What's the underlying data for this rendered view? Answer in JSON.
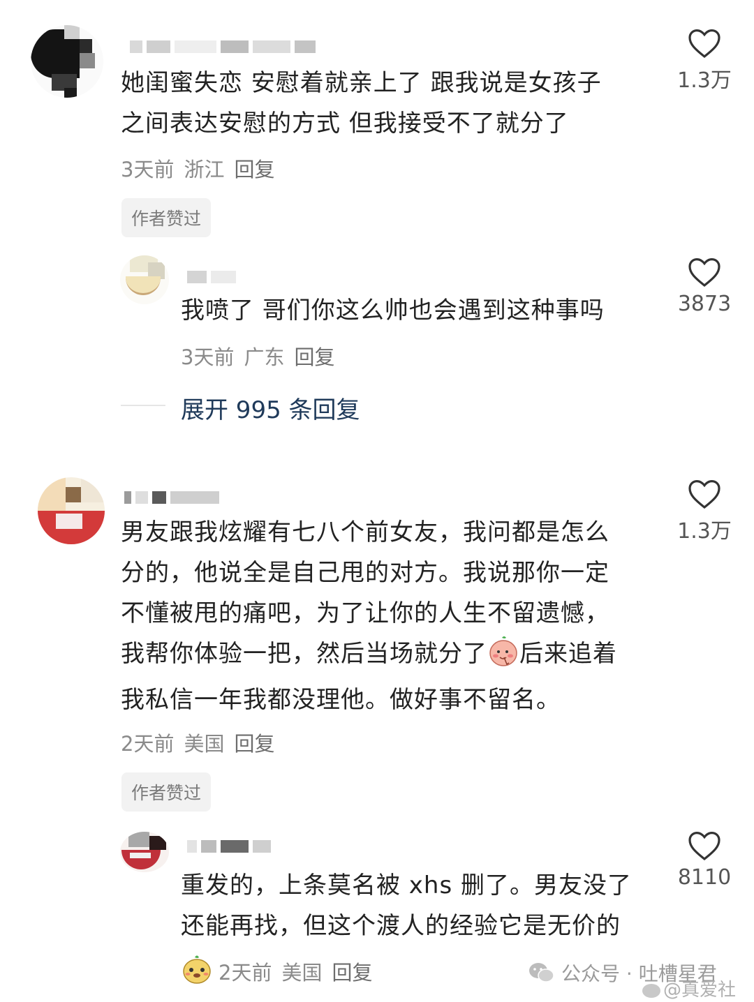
{
  "comments": [
    {
      "text_lines": [
        "她闺蜜失恋 安慰着就亲上了 跟我说是女孩子",
        "之间表达安慰的方式 但我接受不了就分了"
      ],
      "time": "3天前",
      "location": "浙江",
      "reply_label": "回复",
      "badge": "作者赞过",
      "likes": "1.3万",
      "replies": [
        {
          "text_lines": [
            "我喷了 哥们你这么帅也会遇到这种事吗"
          ],
          "time": "3天前",
          "location": "广东",
          "reply_label": "回复",
          "likes": "3873"
        }
      ],
      "expand_label": "展开 995 条回复"
    },
    {
      "text_lines": [
        "男友跟我炫耀有七八个前女友，我问都是怎么",
        "分的，他说全是自己甩的对方。我说那你一定",
        "不懂被甩的痛吧，为了让你的人生不留遗憾，",
        "我帮你体验一把，然后当场就分了",
        "我私信一年我都没理他。做好事不留名。"
      ],
      "text_line4_after_emoji": "后来追着",
      "time": "2天前",
      "location": "美国",
      "reply_label": "回复",
      "badge": "作者赞过",
      "likes": "1.3万",
      "replies": [
        {
          "text_lines": [
            "重发的，上条莫名被 xhs 删了。男友没了",
            "还能再找，但这个渡人的经验它是无价的"
          ],
          "time": "2天前",
          "location": "美国",
          "reply_label": "回复",
          "likes": "8110"
        }
      ]
    }
  ],
  "watermark": {
    "wechat": "公众号 · 吐槽星君",
    "weibo": "@真爱社"
  },
  "icons": {
    "like": "heart-outline-icon",
    "emoji_shy": "blush-emoji-icon",
    "emoji_face": "potato-face-emoji-icon",
    "wechat": "wechat-logo-icon",
    "weibo": "weibo-logo-icon"
  }
}
